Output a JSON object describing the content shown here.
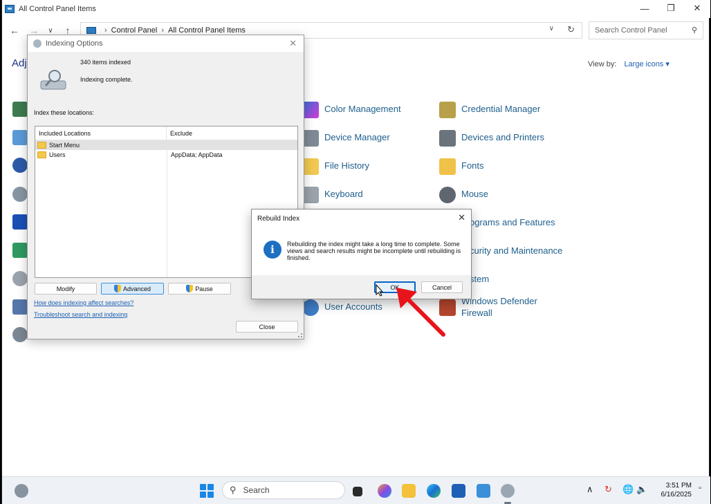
{
  "control_panel": {
    "title": "All Control Panel Items",
    "breadcrumb": [
      "Control Panel",
      "All Control Panel Items"
    ],
    "search_placeholder": "Search Control Panel",
    "heading_partial": "Adj",
    "view_by_label": "View by:",
    "view_by_value": "Large icons",
    "items": [
      {
        "label": "Color Management",
        "icon": "color-management-icon"
      },
      {
        "label": "Credential Manager",
        "icon": "credential-manager-icon"
      },
      {
        "label": "Device Manager",
        "icon": "device-manager-icon"
      },
      {
        "label": "Devices and Printers",
        "icon": "devices-printers-icon"
      },
      {
        "label": "File History",
        "icon": "file-history-icon"
      },
      {
        "label": "Fonts",
        "icon": "fonts-icon"
      },
      {
        "label": "Keyboard",
        "icon": "keyboard-icon"
      },
      {
        "label": "Mouse",
        "icon": "mouse-icon"
      },
      {
        "label": "ograms and Features",
        "icon": "programs-icon"
      },
      {
        "label": "curity and Maintenance",
        "icon": "security-icon"
      },
      {
        "label": "stem",
        "icon": "system-icon"
      },
      {
        "label": "User Accounts",
        "icon": "user-accounts-icon"
      },
      {
        "label": "Windows Defender\nFirewall",
        "icon": "firewall-icon"
      }
    ]
  },
  "indexing_dialog": {
    "title": "Indexing Options",
    "items_indexed": "340 items indexed",
    "status": "Indexing complete.",
    "locations_label": "Index these locations:",
    "columns": [
      "Included Locations",
      "Exclude"
    ],
    "rows": [
      {
        "location": "Start Menu",
        "exclude": ""
      },
      {
        "location": "Users",
        "exclude": "AppData; AppData"
      }
    ],
    "buttons": {
      "modify": "Modify",
      "advanced": "Advanced",
      "pause": "Pause",
      "close": "Close"
    },
    "links": [
      "How does indexing affect searches?",
      "Troubleshoot search and indexing"
    ]
  },
  "rebuild_dialog": {
    "title": "Rebuild Index",
    "message": "Rebuilding the index might take a long time to complete. Some views and search results might be incomplete until rebuilding is finished.",
    "ok_label": "OK",
    "cancel_label": "Cancel"
  },
  "taskbar": {
    "search_label": "Search",
    "time": "3:51 PM",
    "date": "6/16/2025"
  },
  "colors": {
    "accent": "#0a64c4",
    "link": "#1a5fb4",
    "arrow": "#e8141b"
  }
}
